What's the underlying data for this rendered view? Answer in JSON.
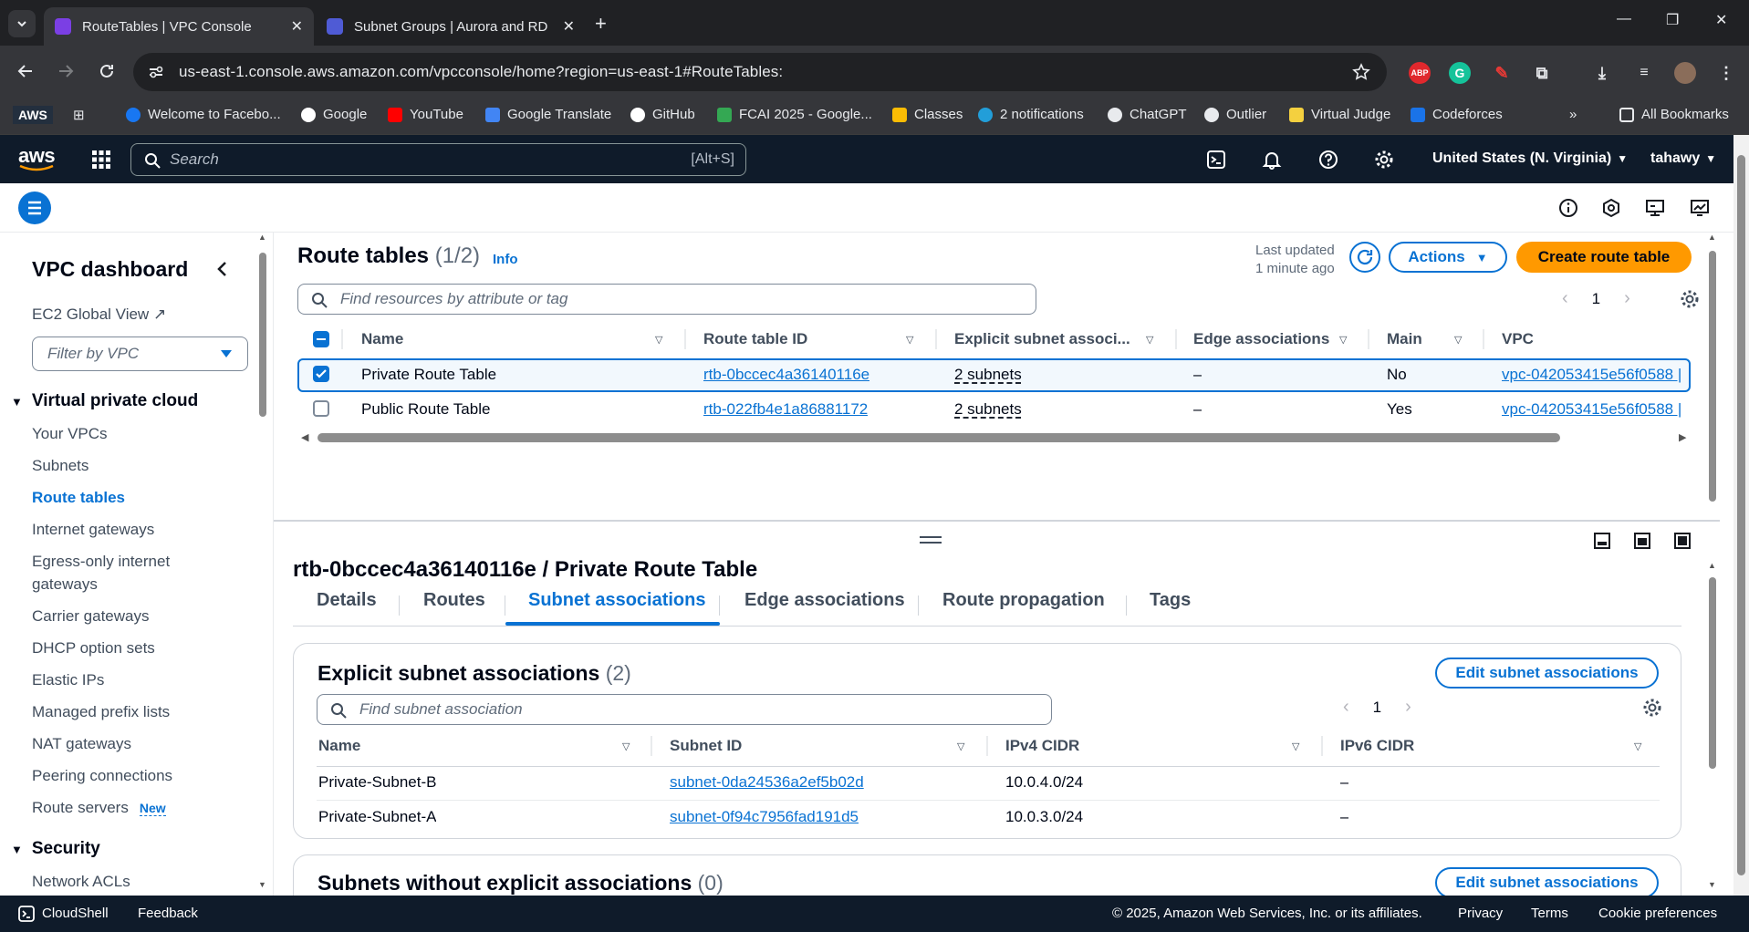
{
  "browser": {
    "tabs": [
      {
        "title": "RouteTables | VPC Console",
        "active": true
      },
      {
        "title": "Subnet Groups | Aurora and RD",
        "active": false
      }
    ],
    "url": "us-east-1.console.aws.amazon.com/vpcconsole/home?region=us-east-1#RouteTables:",
    "bookmarks": [
      "Welcome to Facebo...",
      "Google",
      "YouTube",
      "Google Translate",
      "GitHub",
      "FCAI 2025 - Google...",
      "Classes",
      "2 notifications",
      "ChatGPT",
      "Outlier",
      "Virtual Judge",
      "Codeforces"
    ],
    "all_bookmarks": "All Bookmarks",
    "aws_bookmark": "AWS"
  },
  "aws": {
    "search_placeholder": "Search",
    "search_shortcut": "[Alt+S]",
    "region": "United States (N. Virginia)",
    "user": "tahawy"
  },
  "sidebar": {
    "title": "VPC dashboard",
    "global_view": "EC2 Global View",
    "filter_placeholder": "Filter by VPC",
    "section_vpc": "Virtual private cloud",
    "items": [
      "Your VPCs",
      "Subnets",
      "Route tables",
      "Internet gateways",
      "Egress-only internet",
      "gateways",
      "Carrier gateways",
      "DHCP option sets",
      "Elastic IPs",
      "Managed prefix lists",
      "NAT gateways",
      "Peering connections",
      "Route servers"
    ],
    "new_badge": "New",
    "section_security": "Security",
    "security_items": [
      "Network ACLs"
    ]
  },
  "route_tables": {
    "title": "Route tables",
    "count": "(1/2)",
    "info": "Info",
    "last_updated_line1": "Last updated",
    "last_updated_line2": "1 minute ago",
    "actions": "Actions",
    "create": "Create route table",
    "search_placeholder": "Find resources by attribute or tag",
    "page": "1",
    "columns": [
      "Name",
      "Route table ID",
      "Explicit subnet associ...",
      "Edge associations",
      "Main",
      "VPC"
    ],
    "rows": [
      {
        "name": "Private Route Table",
        "id": "rtb-0bccec4a36140116e",
        "subnets": "2 subnets",
        "edge": "–",
        "main": "No",
        "vpc": "vpc-042053415e56f0588 |",
        "selected": true
      },
      {
        "name": "Public Route Table",
        "id": "rtb-022fb4e1a86881172",
        "subnets": "2 subnets",
        "edge": "–",
        "main": "Yes",
        "vpc": "vpc-042053415e56f0588 |",
        "selected": false
      }
    ]
  },
  "detail": {
    "title": "rtb-0bccec4a36140116e / Private Route Table",
    "tabs": [
      "Details",
      "Routes",
      "Subnet associations",
      "Edge associations",
      "Route propagation",
      "Tags"
    ],
    "explicit": {
      "title": "Explicit subnet associations",
      "count": "(2)",
      "edit": "Edit subnet associations",
      "search_placeholder": "Find subnet association",
      "page": "1",
      "columns": [
        "Name",
        "Subnet ID",
        "IPv4 CIDR",
        "IPv6 CIDR"
      ],
      "rows": [
        {
          "name": "Private-Subnet-B",
          "id": "subnet-0da24536a2ef5b02d",
          "ipv4": "10.0.4.0/24",
          "ipv6": "–"
        },
        {
          "name": "Private-Subnet-A",
          "id": "subnet-0f94c7956fad191d5",
          "ipv4": "10.0.3.0/24",
          "ipv6": "–"
        }
      ]
    },
    "without": {
      "title": "Subnets without explicit associations",
      "count": "(0)",
      "edit": "Edit subnet associations"
    }
  },
  "footer": {
    "cloudshell": "CloudShell",
    "feedback": "Feedback",
    "copyright": "© 2025, Amazon Web Services, Inc. or its affiliates.",
    "privacy": "Privacy",
    "terms": "Terms",
    "cookies": "Cookie preferences"
  }
}
